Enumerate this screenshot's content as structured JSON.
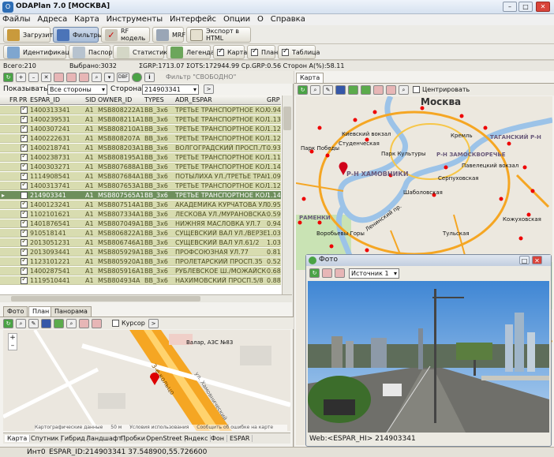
{
  "window": {
    "title": "ODAPlan 7.0  [МОСКВА]",
    "min": "–",
    "max": "□",
    "close": "✕"
  },
  "menu": [
    "Файлы",
    "Адреса",
    "Карта",
    "Инструменты",
    "Интерфейс",
    "Опции",
    "О",
    "Справка"
  ],
  "toolbar1": {
    "load": "Загрузить",
    "filters": "Фильтры",
    "rf_model": "RF модель",
    "mrf": "MRF",
    "export_html": "Экспорт в HTML"
  },
  "toolbar2": {
    "identification": "Идентификация",
    "passport": "Паспорт",
    "statistics": "Статистика",
    "legend": "Легенда",
    "map": "Карта",
    "plan": "План",
    "table": "Таблица"
  },
  "status": {
    "total": "Всего:210",
    "selected": "Выбрано:3032",
    "grp": "ΣGRP:1713.07 ΣOTS:172944.99 Ср.GRP:0.56 Сторон A(%):58.11"
  },
  "filter_bar": {
    "dbf": "DBF",
    "info": "i",
    "filter_label": "Фильтр \"СВОБОДНО\"",
    "show_label": "Показывать:",
    "show_value": "Все стороны",
    "side_label": "Сторона:",
    "side_value": "214903341",
    "go": ">"
  },
  "grid": {
    "columns": [
      "FR",
      "PR",
      "ESPAR_ID",
      "SID",
      "OWNER_ID",
      "TYPES",
      "ADR_ESPAR",
      "GRP"
    ],
    "rows": [
      [
        "1400313341",
        "A1",
        "MSB808222A1",
        "BB_3x6",
        "ТРЕТЬЕ ТРАНСПОРТНОЕ КОЛЬЦО",
        "0.94"
      ],
      [
        "1400239531",
        "A1",
        "MSB808211A1",
        "BB_3x6",
        "ТРЕТЬЕ ТРАНСПОРТНОЕ КОЛЬЦО",
        "1.13"
      ],
      [
        "1400307241",
        "A1",
        "MSB808210A1",
        "BB_3x6",
        "ТРЕТЬЕ ТРАНСПОРТНОЕ КОЛЬЦО",
        "1.12"
      ],
      [
        "1400222631",
        "A1",
        "MSB808207A",
        "BB_3x6",
        "ТРЕТЬЕ ТРАНСПОРТНОЕ КОЛЬЦО",
        "1.12"
      ],
      [
        "1400218741",
        "A1",
        "MSB808203A1",
        "BB_3x6",
        "ВОЛГОГРАДСКИЙ ПРОСП./ТРЕТЬ",
        "0.93"
      ],
      [
        "1400238731",
        "A1",
        "MSB808195A1",
        "BB_3x6",
        "ТРЕТЬЕ ТРАНСПОРТНОЕ КОЛЬЦО",
        "1.11"
      ],
      [
        "1400303271",
        "A1",
        "MSB807688A1",
        "BB_3x6",
        "ТРЕТЬЕ ТРАНСПОРТНОЕ КОЛЬЦО",
        "1.14"
      ],
      [
        "1114908541",
        "A1",
        "MSB807684A1",
        "BB_3x6",
        "ПОТЫЛИХА УЛ./ТРЕТЬЕ ТРАНСП",
        "1.09"
      ],
      [
        "1400313741",
        "A1",
        "MSB807653A1",
        "BB_3x6",
        "ТРЕТЬЕ ТРАНСПОРТНОЕ КОЛЬЦО",
        "1.12"
      ],
      [
        "214903341",
        "A1",
        "MSB807565A1",
        "BB_3x6",
        "ТРЕТЬЕ ТРАНСПОРТНОЕ КОЛЬЦО",
        "1.14"
      ],
      [
        "1400123241",
        "A1",
        "MSB807514A1",
        "BB_3x6",
        "АКАДЕМИКА КУРЧАТОВА УЛ./ВО",
        "0.95"
      ],
      [
        "1102101621",
        "A1",
        "MSB807334A1",
        "BB_3x6",
        "ЛЕСКОВА УЛ./МУРАНОВСКАЯ УЛ",
        "0.59"
      ],
      [
        "1401876541",
        "A1",
        "MSB807049A1",
        "BB_3x6",
        "НИЖНЯЯ МАСЛОВКА УЛ.7",
        "0.94"
      ],
      [
        "910518141",
        "A1",
        "MSB806822A1",
        "BB_3x6",
        "СУЩЕВСКИЙ ВАЛ УЛ./ВЕРЗЕМНЕ",
        "1.03"
      ],
      [
        "2013051231",
        "A1",
        "MSB806746A1",
        "BB_3x6",
        "СУЩЕВСКИЙ ВАЛ УЛ.61/2",
        "1.03"
      ],
      [
        "2013093441",
        "A1",
        "MSB805929A1",
        "BB_3x6",
        "ПРОФСОЮЗНАЯ УЛ.77",
        "0.81"
      ],
      [
        "1123101221",
        "A1",
        "MSB805920A1",
        "BB_3x6",
        "ПРОЛЕТАРСКИЙ ПРОСП.35",
        "0.52"
      ],
      [
        "1400287541",
        "A1",
        "MSB805916A1",
        "BB_3x6",
        "РУБЛЕВСКОЕ Ш./МОЖАЙСКОЕ Ш",
        "0.68"
      ],
      [
        "1119510441",
        "A1",
        "MSB804934A",
        "BB_3x6",
        "НАХИМОВСКИЙ ПРОСП.5/8",
        "0.88"
      ]
    ]
  },
  "bottom_left": {
    "tabs": [
      "Фото",
      "План",
      "Панорама"
    ],
    "cursor": "Курсор",
    "go": ">",
    "zoom_in": "+",
    "zoom_out": "–",
    "labels": {
      "gas": "Валар, АЗС №83",
      "ring": "3-е кольцо",
      "street": "ул. Хамовнический",
      "copyright": "Картографические данные",
      "scale": "50 м",
      "terms": "Условия использования",
      "report": "Сообщить об ошибке на карте"
    },
    "map_types": [
      "Карта",
      "Спутник",
      "Гибрид",
      "Ландшафт",
      "Пробки",
      "OpenStreet",
      "Яндекс",
      "Фон",
      "ESPAR"
    ]
  },
  "right_map": {
    "tab": "Карта",
    "center": "Центрировать",
    "labels": {
      "moscow": "Москва",
      "khamovniki": "Р-Н ХАМОВНИКИ",
      "zamoskvorechye": "Р-Н ЗАМОСКВОРЕЧЬЕ",
      "kiev": "Киевский вокзал",
      "studench": "Студенческая",
      "park_kultury": "Парк Культуры",
      "park_pobedy": "Парк Победы",
      "shabolovskaya": "Шаболовская",
      "serpukhovskaya": "Серпуховская",
      "paveletsky": "Павелецкий вокзал",
      "tulskaya": "Тульская",
      "vorobyovy": "Воробьевы Горы",
      "leninsky": "Ленинский пр.",
      "ramenki": "РАМЕНКИ",
      "kremlin": "Кремль",
      "taganka": "ТАГАНСКИЙ Р-Н",
      "kuskovo": "Кожуховская"
    }
  },
  "photo": {
    "title": "Фото",
    "source": "Источник 1",
    "caption": "Web:<ESPAR_HI> 214903341"
  },
  "bottom_status": {
    "int": "Инт0",
    "espar": "ESPAR_ID:214903341 37.548900,55.726600"
  }
}
